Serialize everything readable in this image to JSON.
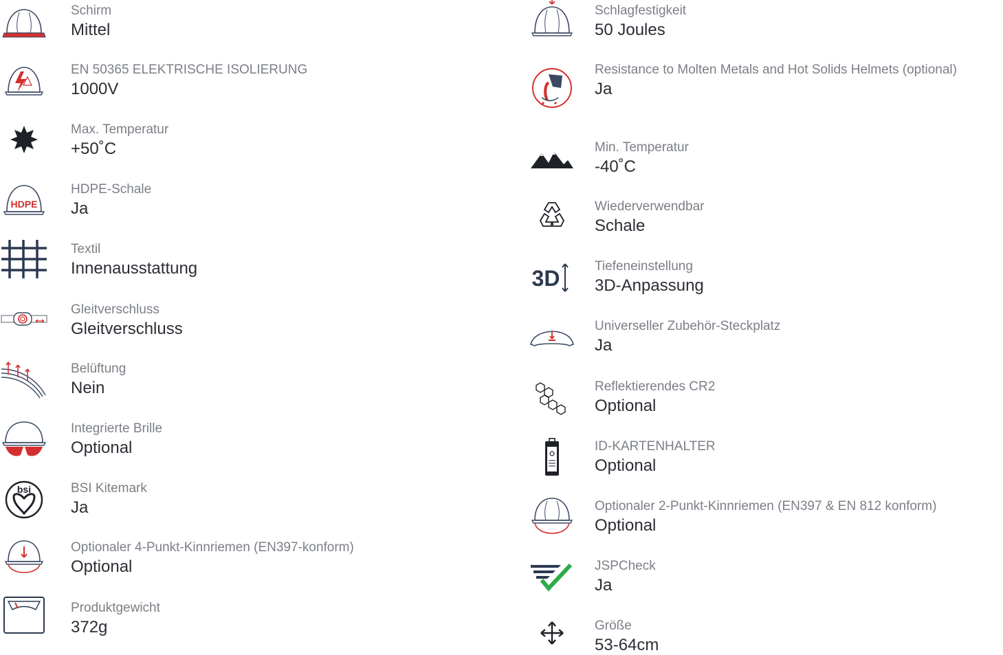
{
  "colors": {
    "icon": "#3a4a63",
    "accent": "#d32f2f",
    "check": "#2eaa4a"
  },
  "left": [
    {
      "label": "Schirm",
      "value": "Mittel",
      "icon": "helmet-brim-icon"
    },
    {
      "label": "EN 50365 ELEKTRISCHE ISOLIERUNG",
      "value": "1000V",
      "icon": "helmet-electrical-icon"
    },
    {
      "label": "Max. Temperatur",
      "value": "+50˚C",
      "icon": "sun-icon"
    },
    {
      "label": "HDPE-Schale",
      "value": "Ja",
      "icon": "helmet-hdpe-icon",
      "badge": "HDPE"
    },
    {
      "label": "Textil",
      "value": "Innenausstattung",
      "icon": "textile-icon"
    },
    {
      "label": "Gleitverschluss",
      "value": "Gleitverschluss",
      "icon": "slider-fingerprint-icon"
    },
    {
      "label": "Belüftung",
      "value": "Nein",
      "icon": "ventilation-icon"
    },
    {
      "label": "Integrierte Brille",
      "value": "Optional",
      "icon": "helmet-goggles-icon"
    },
    {
      "label": "BSI Kitemark",
      "value": "Ja",
      "icon": "bsi-kitemark-icon",
      "badge": "bsi"
    },
    {
      "label": "Optionaler 4-Punkt-Kinnriemen (EN397-konform)",
      "value": "Optional",
      "icon": "helmet-chinstrap-4pt-icon"
    },
    {
      "label": "Produktgewicht",
      "value": "372g",
      "icon": "scale-icon"
    }
  ],
  "right": [
    {
      "label": "Schlagfestigkeit",
      "value": "50 Joules",
      "icon": "helmet-impact-icon"
    },
    {
      "label": "Resistance to Molten Metals and Hot Solids Helmets (optional)",
      "value": "Ja",
      "icon": "molten-metal-icon"
    },
    {
      "label": "Min. Temperatur",
      "value": "-40˚C",
      "icon": "mountains-icon"
    },
    {
      "label": "Wiederverwendbar",
      "value": "Schale",
      "icon": "recycle-icon"
    },
    {
      "label": "Tiefeneinstellung",
      "value": "3D-Anpassung",
      "icon": "3d-adjust-icon",
      "badge": "3D"
    },
    {
      "label": "Universeller Zubehör-Steckplatz",
      "value": "Ja",
      "icon": "helmet-accessory-slot-icon"
    },
    {
      "label": "Reflektierendes CR2",
      "value": "Optional",
      "icon": "hexagons-icon"
    },
    {
      "label": "ID-KARTENHALTER",
      "value": "Optional",
      "icon": "id-card-holder-icon"
    },
    {
      "label": "Optionaler 2-Punkt-Kinnriemen (EN397 & EN 812 konform)",
      "value": "Optional",
      "icon": "helmet-chinstrap-2pt-icon"
    },
    {
      "label": "JSPCheck",
      "value": "Ja",
      "icon": "jspcheck-icon"
    },
    {
      "label": "Größe",
      "value": "53-64cm",
      "icon": "size-arrows-icon"
    }
  ]
}
